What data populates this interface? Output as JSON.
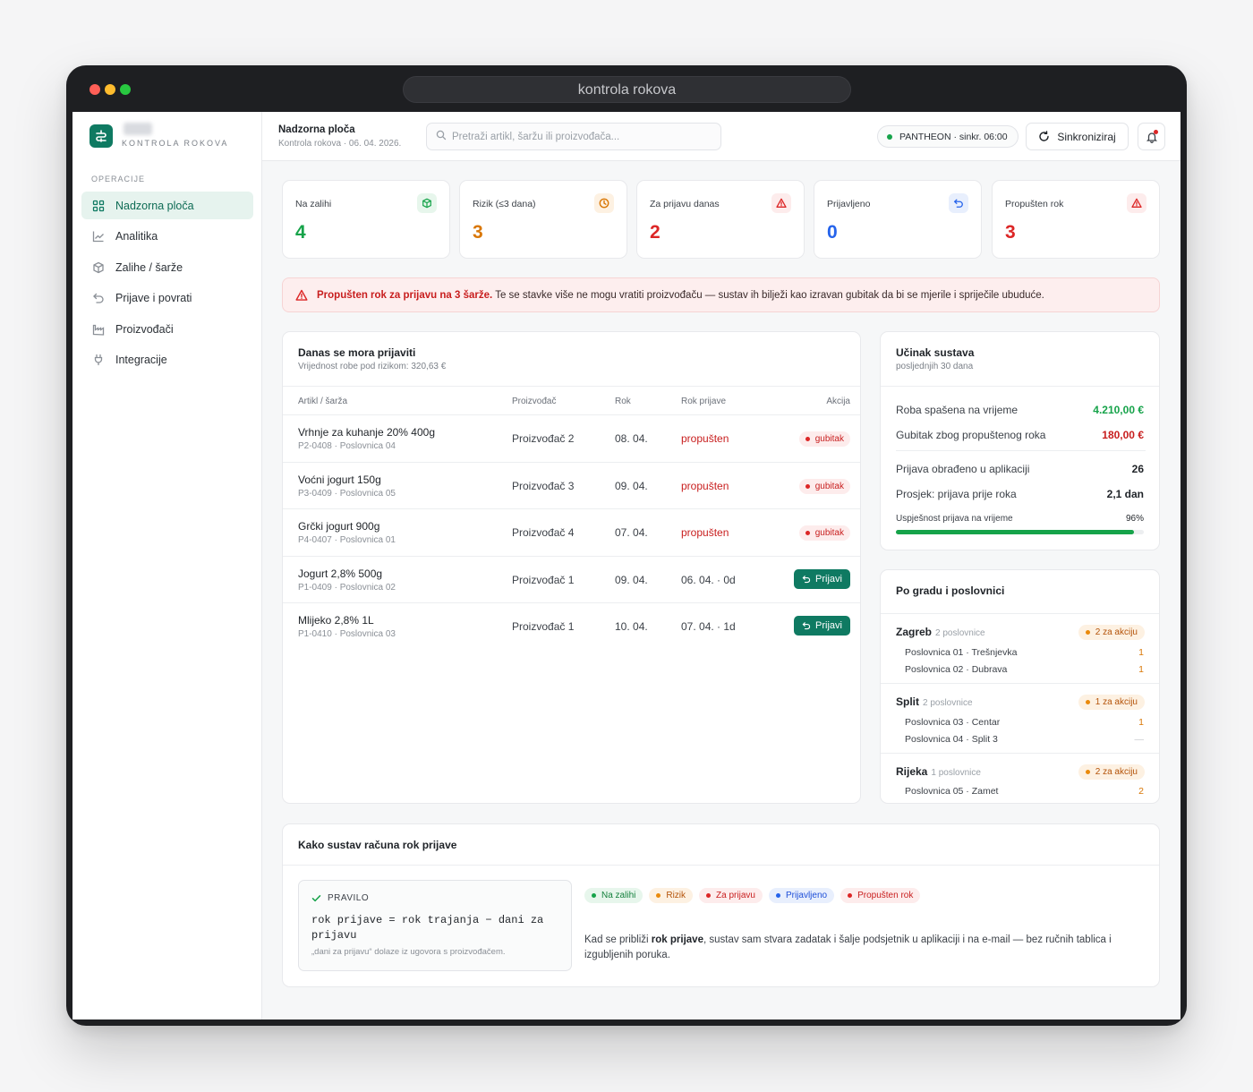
{
  "window": {
    "url": "kontrola rokova"
  },
  "brand": {
    "subtitle": "KONTROLA ROKOVA"
  },
  "sidebar": {
    "section": "OPERACIJE",
    "items": [
      {
        "label": "Nadzorna ploča",
        "icon": "grid-icon",
        "active": true
      },
      {
        "label": "Analitika",
        "icon": "chart-line-icon"
      },
      {
        "label": "Zalihe / šarže",
        "icon": "box-icon"
      },
      {
        "label": "Prijave i povrati",
        "icon": "return-icon"
      },
      {
        "label": "Proizvođači",
        "icon": "factory-icon"
      },
      {
        "label": "Integracije",
        "icon": "plug-icon"
      }
    ]
  },
  "header": {
    "title": "Nadzorna ploča",
    "subtitle": "Kontrola rokova · 06. 04. 2026.",
    "search_placeholder": "Pretraži artikl, šaržu ili proizvođača...",
    "sync_status": "PANTHEON · sinkr. 06:00",
    "sync_button": "Sinkroniziraj"
  },
  "kpis": [
    {
      "label": "Na zalihi",
      "value": "4",
      "color": "#16a34a",
      "icon": "box-icon",
      "icon_bg": "#e7f6ec"
    },
    {
      "label": "Rizik (≤3 dana)",
      "value": "3",
      "color": "#d97706",
      "icon": "clock-icon",
      "icon_bg": "#fdf1e2"
    },
    {
      "label": "Za prijavu danas",
      "value": "2",
      "color": "#dc2626",
      "icon": "warning-icon",
      "icon_bg": "#fdecec"
    },
    {
      "label": "Prijavljeno",
      "value": "0",
      "color": "#2563eb",
      "icon": "return-icon",
      "icon_bg": "#e8effd"
    },
    {
      "label": "Propušten rok",
      "value": "3",
      "color": "#dc2626",
      "icon": "warning-icon",
      "icon_bg": "#fdecec"
    }
  ],
  "alert": {
    "strong": "Propušten rok za prijavu na 3 šarže.",
    "text": " Te se stavke više ne mogu vratiti proizvođaču — sustav ih bilježi kao izravan gubitak da bi se mjerile i spriječile ubuduće."
  },
  "due_table": {
    "title": "Danas se mora prijaviti",
    "subtitle": "Vrijednost robe pod rizikom: 320,63 €",
    "columns": [
      "Artikl / šarža",
      "Proizvođač",
      "Rok",
      "Rok prijave",
      "Akcija"
    ],
    "rows": [
      {
        "name": "Vrhnje za kuhanje 20% 400g",
        "batch": "P2-0408 · Poslovnica 04",
        "producer": "Proizvođač 2",
        "due": "08. 04.",
        "report_due": "propušten",
        "action": "gubitak",
        "missed": true
      },
      {
        "name": "Voćni jogurt 150g",
        "batch": "P3-0409 · Poslovnica 05",
        "producer": "Proizvođač 3",
        "due": "09. 04.",
        "report_due": "propušten",
        "action": "gubitak",
        "missed": true
      },
      {
        "name": "Grčki jogurt 900g",
        "batch": "P4-0407 · Poslovnica 01",
        "producer": "Proizvođač 4",
        "due": "07. 04.",
        "report_due": "propušten",
        "action": "gubitak",
        "missed": true
      },
      {
        "name": "Jogurt 2,8% 500g",
        "batch": "P1-0409 · Poslovnica 02",
        "producer": "Proizvođač 1",
        "due": "09. 04.",
        "report_due": "06. 04. · 0d",
        "action": "Prijavi",
        "missed": false
      },
      {
        "name": "Mlijeko 2,8% 1L",
        "batch": "P1-0410 · Poslovnica 03",
        "producer": "Proizvođač 1",
        "due": "10. 04.",
        "report_due": "07. 04. · 1d",
        "action": "Prijavi",
        "missed": false
      }
    ]
  },
  "performance": {
    "title": "Učinak sustava",
    "subtitle": "posljednjih 30 dana",
    "saved_label": "Roba spašena na vrijeme",
    "saved_value": "4.210,00 €",
    "loss_label": "Gubitak zbog propuštenog roka",
    "loss_value": "180,00 €",
    "handled_label": "Prijava obrađeno u aplikaciji",
    "handled_value": "26",
    "avg_label": "Prosjek: prijava prije roka",
    "avg_value": "2,1 dan",
    "success_label": "Uspješnost prijava na vrijeme",
    "success_value": "96%",
    "success_fraction": 0.96
  },
  "cities": {
    "title": "Po gradu i poslovnici",
    "groups": [
      {
        "name": "Zagreb",
        "count": "2 poslovnice",
        "badge": "2 za akciju",
        "branches": [
          {
            "name": "Poslovnica 01 · Trešnjevka",
            "value": "1"
          },
          {
            "name": "Poslovnica 02 · Dubrava",
            "value": "1"
          }
        ]
      },
      {
        "name": "Split",
        "count": "2 poslovnice",
        "badge": "1 za akciju",
        "branches": [
          {
            "name": "Poslovnica 03 · Centar",
            "value": "1"
          },
          {
            "name": "Poslovnica 04 · Split 3",
            "value": "—"
          }
        ]
      },
      {
        "name": "Rijeka",
        "count": "1 poslovnice",
        "badge": "2 za akciju",
        "branches": [
          {
            "name": "Poslovnica 05 · Zamet",
            "value": "2"
          }
        ]
      }
    ]
  },
  "rule": {
    "title": "Kako sustav računa rok prijave",
    "label": "PRAVILO",
    "formula": "rok prijave = rok trajanja − dani za prijavu",
    "note": "„dani za prijavu“ dolaze iz ugovora s proizvođačem.",
    "legend": [
      {
        "label": "Na zalihi",
        "fg": "#15803d",
        "bg": "#e7f6ec",
        "dot": "#16a34a"
      },
      {
        "label": "Rizik",
        "fg": "#b45309",
        "bg": "#fdf1e2",
        "dot": "#ea8a0c"
      },
      {
        "label": "Za prijavu",
        "fg": "#c81e1e",
        "bg": "#fdecec",
        "dot": "#dc2626"
      },
      {
        "label": "Prijavljeno",
        "fg": "#1d4ed8",
        "bg": "#e8effd",
        "dot": "#2563eb"
      },
      {
        "label": "Propušten rok",
        "fg": "#c81e1e",
        "bg": "#fdecec",
        "dot": "#dc2626"
      }
    ],
    "text_before": "Kad se približi ",
    "text_bold": "rok prijave",
    "text_after": ", sustav sam stvara zadatak i šalje podsjetnik u aplikaciji i na e-mail — bez ručnih tablica i izgubljenih poruka."
  }
}
